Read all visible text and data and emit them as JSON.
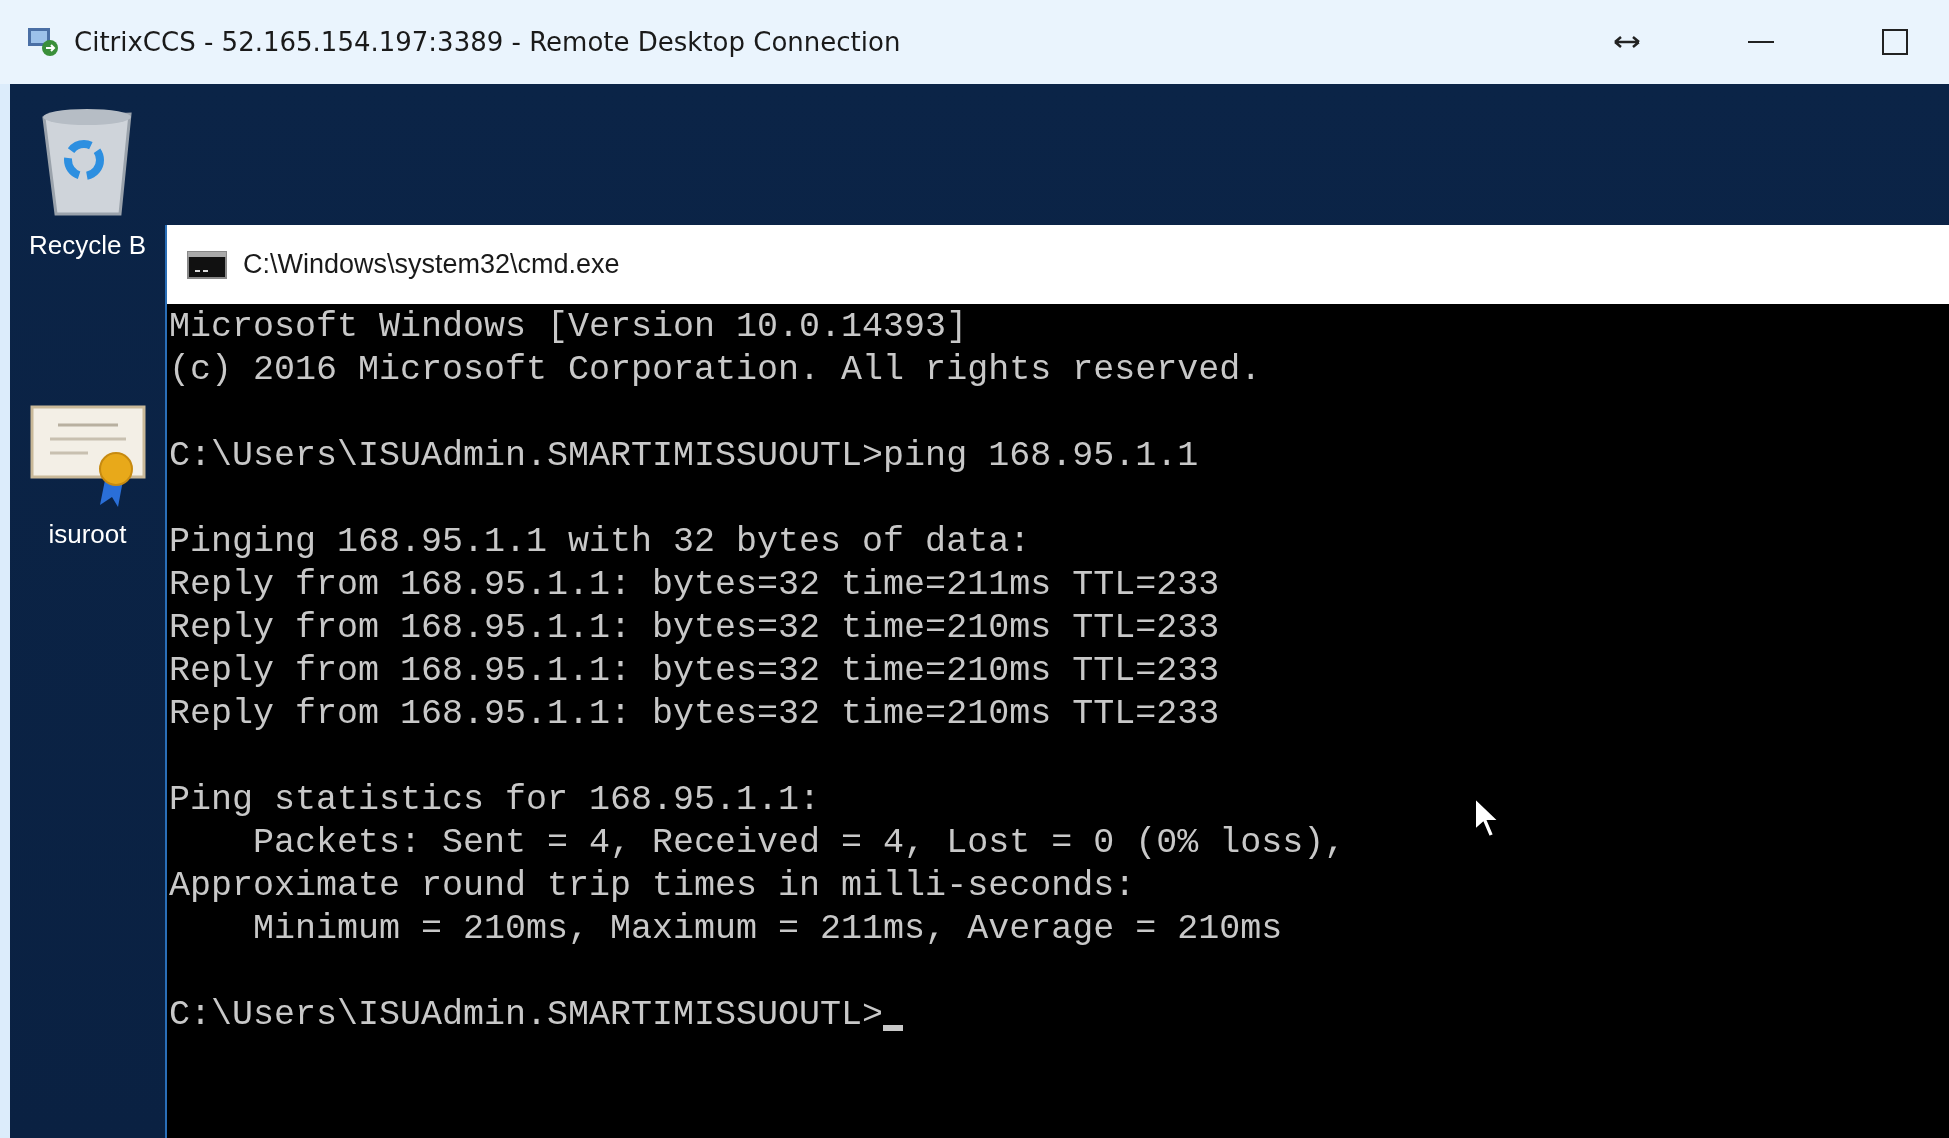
{
  "window": {
    "title": "CitrixCCS - 52.165.154.197:3389 - Remote Desktop Connection"
  },
  "desktop_icons": [
    {
      "kind": "recycle",
      "label": "Recycle B"
    },
    {
      "kind": "certificate",
      "label": "isuroot"
    }
  ],
  "cmd_window": {
    "title": "C:\\Windows\\system32\\cmd.exe",
    "blocks": [
      [
        "Microsoft Windows [Version 10.0.14393]",
        "(c) 2016 Microsoft Corporation. All rights reserved."
      ],
      [
        "C:\\Users\\ISUAdmin.SMARTIMISSUOUTL>ping 168.95.1.1"
      ],
      [
        "Pinging 168.95.1.1 with 32 bytes of data:",
        "Reply from 168.95.1.1: bytes=32 time=211ms TTL=233",
        "Reply from 168.95.1.1: bytes=32 time=210ms TTL=233",
        "Reply from 168.95.1.1: bytes=32 time=210ms TTL=233",
        "Reply from 168.95.1.1: bytes=32 time=210ms TTL=233"
      ],
      [
        "Ping statistics for 168.95.1.1:",
        "    Packets: Sent = 4, Received = 4, Lost = 0 (0% loss),",
        "Approximate round trip times in milli-seconds:",
        "    Minimum = 210ms, Maximum = 211ms, Average = 210ms"
      ],
      [
        "C:\\Users\\ISUAdmin.SMARTIMISSUOUTL>"
      ]
    ]
  }
}
